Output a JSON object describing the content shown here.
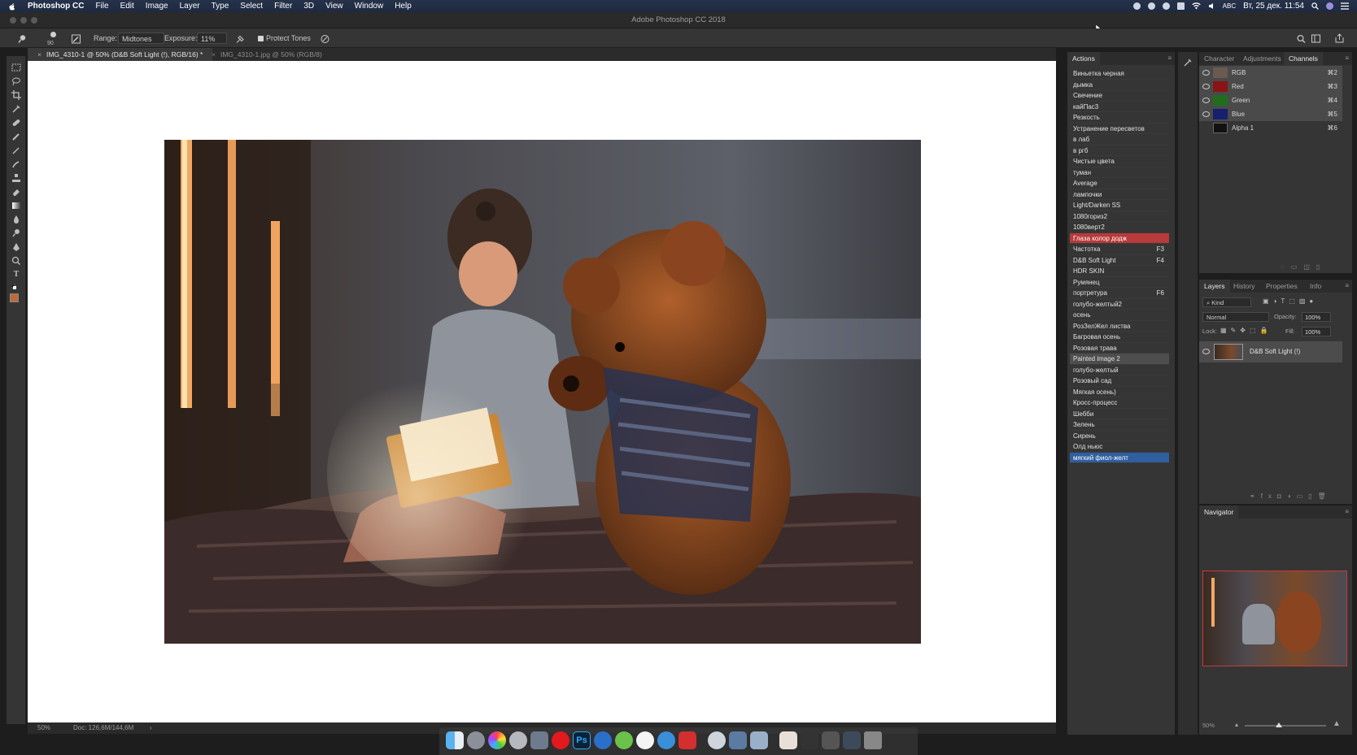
{
  "menubar": {
    "app_name": "Photoshop CC",
    "menus": [
      "File",
      "Edit",
      "Image",
      "Layer",
      "Type",
      "Select",
      "Filter",
      "3D",
      "View",
      "Window",
      "Help"
    ],
    "input_lang": "ABC",
    "clock": "Вт, 25 дек.  11:54"
  },
  "window": {
    "title": "Adobe Photoshop CC 2018"
  },
  "options_bar": {
    "brush_size": "90",
    "range_label": "Range:",
    "range_value": "Midtones",
    "exposure_label": "Exposure:",
    "exposure_value": "11%",
    "protect_tones_label": "Protect Tones",
    "protect_tones_checked": true
  },
  "document_tabs": [
    {
      "label": "IMG_4310-1 @ 50% (D&B Soft Light (!), RGB/16) *",
      "active": true
    },
    {
      "label": "IMG_4310-1.jpg @ 50% (RGB/8)",
      "active": false
    }
  ],
  "status": {
    "zoom": "50%",
    "doc": "Doc: 126,6M/144,6M"
  },
  "actions_panel": {
    "tab": "Actions",
    "items": [
      {
        "label": "Виньетка черная",
        "key": "",
        "state": ""
      },
      {
        "label": "дымка",
        "key": "",
        "state": ""
      },
      {
        "label": "Свечение",
        "key": "",
        "state": ""
      },
      {
        "label": "кайПас3",
        "key": "",
        "state": ""
      },
      {
        "label": "Резкость",
        "key": "",
        "state": ""
      },
      {
        "label": "Устранение пересветов",
        "key": "",
        "state": ""
      },
      {
        "label": "в лаб",
        "key": "",
        "state": ""
      },
      {
        "label": "в ргб",
        "key": "",
        "state": ""
      },
      {
        "label": "Чистые цвета",
        "key": "",
        "state": ""
      },
      {
        "label": "туман",
        "key": "",
        "state": ""
      },
      {
        "label": "Average",
        "key": "",
        "state": ""
      },
      {
        "label": "лампочки",
        "key": "",
        "state": ""
      },
      {
        "label": "Light/Darken SS",
        "key": "",
        "state": ""
      },
      {
        "label": "1080гориз2",
        "key": "",
        "state": ""
      },
      {
        "label": "1080верт2",
        "key": "",
        "state": ""
      },
      {
        "label": "Глаза колор додж",
        "key": "",
        "state": "red"
      },
      {
        "label": "Частотка",
        "key": "F3",
        "state": ""
      },
      {
        "label": "D&B Soft Light",
        "key": "F4",
        "state": ""
      },
      {
        "label": "HDR SKIN",
        "key": "",
        "state": ""
      },
      {
        "label": "Румянец",
        "key": "",
        "state": ""
      },
      {
        "label": "портретура",
        "key": "F6",
        "state": ""
      },
      {
        "label": "голубо-желтый2",
        "key": "",
        "state": ""
      },
      {
        "label": "осень",
        "key": "",
        "state": ""
      },
      {
        "label": "РозЗелЖел листва",
        "key": "",
        "state": ""
      },
      {
        "label": "Багровая осень",
        "key": "",
        "state": ""
      },
      {
        "label": "Розовая трава",
        "key": "",
        "state": ""
      },
      {
        "label": "Painted image 2",
        "key": "",
        "state": "grey"
      },
      {
        "label": "голубо-желтый",
        "key": "",
        "state": ""
      },
      {
        "label": "Розовый сад",
        "key": "",
        "state": ""
      },
      {
        "label": "Мягкая осень)",
        "key": "",
        "state": ""
      },
      {
        "label": "Кросс-процесс",
        "key": "",
        "state": ""
      },
      {
        "label": "Шебби",
        "key": "",
        "state": ""
      },
      {
        "label": "Зелень",
        "key": "",
        "state": ""
      },
      {
        "label": "Сирень",
        "key": "",
        "state": ""
      },
      {
        "label": "Олд ньюс",
        "key": "",
        "state": ""
      },
      {
        "label": "мягкий фиол-желт",
        "key": "",
        "state": "blue"
      }
    ]
  },
  "channels_panel": {
    "tabs": [
      "Character",
      "Adjustments",
      "Channels"
    ],
    "active_tab": "Channels",
    "channels": [
      {
        "name": "RGB",
        "key": "⌘2",
        "color": "#6a5a50",
        "visible": true
      },
      {
        "name": "Red",
        "key": "⌘3",
        "color": "#8a1414",
        "visible": true
      },
      {
        "name": "Green",
        "key": "⌘4",
        "color": "#1e6e1e",
        "visible": true
      },
      {
        "name": "Blue",
        "key": "⌘5",
        "color": "#16206e",
        "visible": true
      },
      {
        "name": "Alpha 1",
        "key": "⌘6",
        "color": "#111111",
        "visible": false
      }
    ]
  },
  "layers_panel": {
    "tabs": [
      "Layers",
      "History",
      "Properties",
      "Info"
    ],
    "active_tab": "Layers",
    "kind_label": "Kind",
    "blend_mode": "Normal",
    "opacity_label": "Opacity:",
    "opacity_value": "100%",
    "lock_label": "Lock:",
    "fill_label": "Fill:",
    "fill_value": "100%",
    "layer_name": "D&B Soft Light (!)"
  },
  "navigator_panel": {
    "tab": "Navigator",
    "zoom": "50%"
  }
}
